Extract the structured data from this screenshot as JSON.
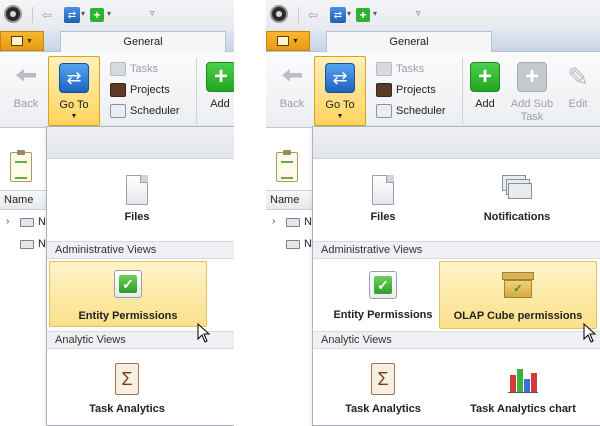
{
  "panels": [
    {
      "tab": "General",
      "ribbon": {
        "back": "Back",
        "goto": "Go To",
        "tasks": "Tasks",
        "projects": "Projects",
        "scheduler": "Scheduler",
        "add": "Add"
      },
      "grid": {
        "header": "Name",
        "rows": [
          "N",
          "N"
        ]
      },
      "gallery": {
        "top_items": [
          "Files"
        ],
        "sections": [
          {
            "title": "Administrative Views",
            "items": [
              "Entity Permissions"
            ]
          },
          {
            "title": "Analytic Views",
            "items": [
              "Task Analytics"
            ]
          }
        ],
        "hovered": "Entity Permissions"
      }
    },
    {
      "tab": "General",
      "ribbon": {
        "back": "Back",
        "goto": "Go To",
        "tasks": "Tasks",
        "projects": "Projects",
        "scheduler": "Scheduler",
        "add": "Add",
        "add_sub_task": "Add Sub Task",
        "edit": "Edit"
      },
      "grid": {
        "header": "Name",
        "rows": [
          "N",
          "N"
        ]
      },
      "gallery": {
        "top_items": [
          "Files",
          "Notifications"
        ],
        "sections": [
          {
            "title": "Administrative Views",
            "items": [
              "Entity Permissions",
              "OLAP Cube permissions"
            ]
          },
          {
            "title": "Analytic Views",
            "items": [
              "Task Analytics",
              "Task Analytics chart"
            ]
          }
        ],
        "hovered": "OLAP Cube permissions"
      }
    }
  ],
  "colors": {
    "goto_active": "#ffd45f",
    "hover_item": "#fbe08a",
    "add_green": "#2db32d",
    "app_menu": "#f0a820"
  },
  "icons": {
    "files": "file-icon",
    "notifications": "envelopes-icon",
    "entity_permissions": "checkmark-icon",
    "olap": "cube-box-icon",
    "task_analytics": "sigma-icon",
    "task_analytics_chart": "bar-chart-icon"
  }
}
